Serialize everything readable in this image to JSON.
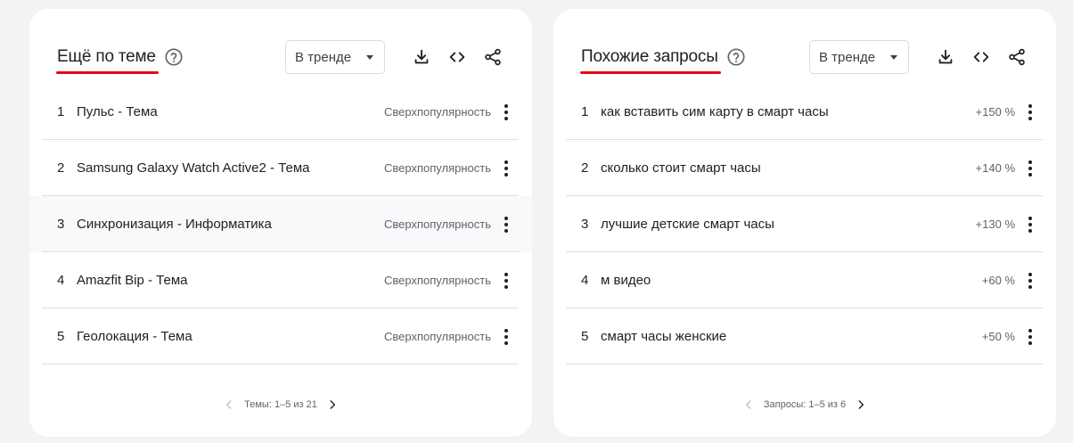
{
  "left_card": {
    "title": "Ещё по теме",
    "filter": "В тренде",
    "rows": [
      {
        "rank": "1",
        "label": "Пульс - Тема",
        "value": "Сверхпопулярность"
      },
      {
        "rank": "2",
        "label": "Samsung Galaxy Watch Active2 - Тема",
        "value": "Сверхпопулярность"
      },
      {
        "rank": "3",
        "label": "Синхронизация - Информатика",
        "value": "Сверхпопулярность"
      },
      {
        "rank": "4",
        "label": "Amazfit Bip - Тема",
        "value": "Сверхпопулярность"
      },
      {
        "rank": "5",
        "label": "Геолокация - Тема",
        "value": "Сверхпопулярность"
      }
    ],
    "pagination": "Темы: 1–5 из 21"
  },
  "right_card": {
    "title": "Похожие запросы",
    "filter": "В тренде",
    "rows": [
      {
        "rank": "1",
        "label": "как вставить сим карту в смарт часы",
        "value": "+150 %"
      },
      {
        "rank": "2",
        "label": "сколько стоит смарт часы",
        "value": "+140 %"
      },
      {
        "rank": "3",
        "label": "лучшие детские смарт часы",
        "value": "+130 %"
      },
      {
        "rank": "4",
        "label": "м видео",
        "value": "+60 %"
      },
      {
        "rank": "5",
        "label": "смарт часы женские",
        "value": "+50 %"
      }
    ],
    "pagination": "Запросы: 1–5 из 6"
  },
  "icons": {
    "help": "help-circle-icon",
    "download": "download-icon",
    "embed": "code-icon",
    "share": "share-icon",
    "more": "more-vert-icon",
    "prev": "chevron-left-icon",
    "next": "chevron-right-icon",
    "dropdown": "caret-down-icon"
  },
  "colors": {
    "title_underline": "#e50914",
    "background": "#f1f3f4",
    "card": "#ffffff",
    "text": "#202124",
    "secondary_text": "#5f6368"
  }
}
